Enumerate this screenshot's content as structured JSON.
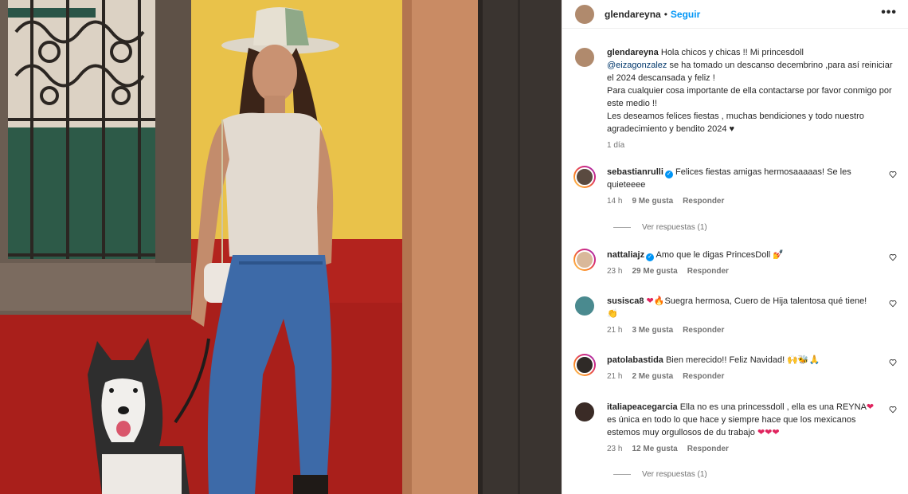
{
  "post": {
    "author": "glendareyna",
    "follow_label": "Seguir",
    "separator": "•",
    "more_label": "•••",
    "caption_author": "glendareyna",
    "caption_parts": {
      "p1": "Hola chicos y chicas !! Mi princesdoll",
      "mention": "@eizagonzalez",
      "p2": "se ha tomado un descanso decembrino ,para así reiniciar el 2024 descansada y feliz !",
      "p3": "Para cualquier cosa importante de ella contactarse por favor conmigo por este medio !!",
      "p4": "Les deseamos felices fiestas , muchas bendiciones y todo nuestro agradecimiento y bendito 2024 ♥"
    },
    "caption_time": "1 día"
  },
  "comments": [
    {
      "user": "sebastianrulli",
      "verified": true,
      "text": "Felices fiestas amigas hermosaaaaas! Se les quieteeee",
      "time": "14 h",
      "likes": "9 Me gusta",
      "reply": "Responder",
      "view_replies": "Ver respuestas (1)"
    },
    {
      "user": "nattaliajz",
      "verified": true,
      "text": "Amo que le digas PrincesDoll",
      "emoji": "💅",
      "time": "23 h",
      "likes": "29 Me gusta",
      "reply": "Responder"
    },
    {
      "user": "susisca8",
      "verified": false,
      "text_pre": "❤🔥",
      "text": "Suegra hermosa, Cuero de Hija talentosa qué tiene!",
      "emoji": "👏",
      "time": "21 h",
      "likes": "3 Me gusta",
      "reply": "Responder"
    },
    {
      "user": "patolabastida",
      "verified": false,
      "text": "Bien merecido!! Feliz Navidad!",
      "emoji": "🙌🐝🙏",
      "time": "21 h",
      "likes": "2 Me gusta",
      "reply": "Responder"
    },
    {
      "user": "italiapeacegarcia",
      "verified": false,
      "text_a": "Ella no es una princessdoll , ella es una REYNA",
      "heart1": "❤",
      "text_b": "es única en todo lo que hace y siempre hace que los mexicanos estemos muy orgullosos de du trabajo",
      "hearts": "❤❤❤",
      "time": "23 h",
      "likes": "12 Me gusta",
      "reply": "Responder",
      "view_replies": "Ver respuestas (1)"
    }
  ],
  "colors": {
    "link": "#0095f6",
    "mention": "#00376b",
    "meta": "#737373",
    "heart": "#e0245e"
  },
  "icons": {
    "verified": "verified-badge-icon",
    "like": "heart-outline-icon",
    "more": "more-options-icon"
  }
}
